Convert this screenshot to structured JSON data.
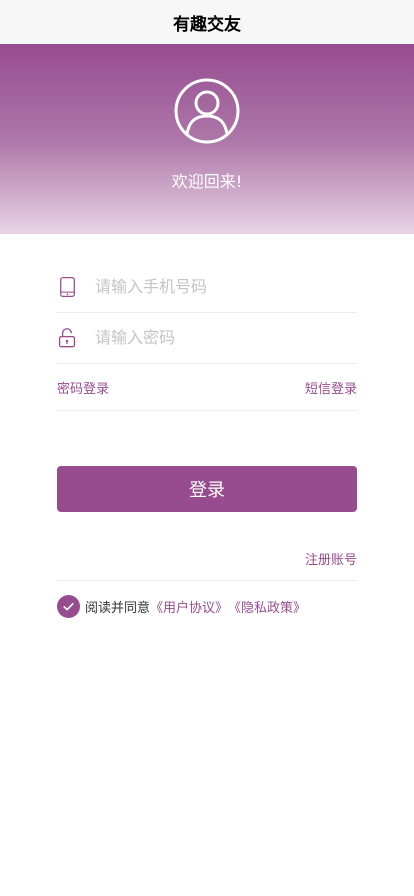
{
  "nav": {
    "title": "有趣交友"
  },
  "header": {
    "welcome_text": "欢迎回来!",
    "avatar_icon": "user-avatar-icon",
    "gradient_top": "#974c90",
    "gradient_bottom": "#e8d3e5"
  },
  "form": {
    "phone": {
      "icon": "phone-icon",
      "placeholder": "请输入手机号码",
      "value": ""
    },
    "password": {
      "icon": "lock-icon",
      "placeholder": "请输入密码",
      "value": ""
    },
    "password_login_label": "密码登录",
    "sms_login_label": "短信登录",
    "login_button_label": "登录",
    "register_label": "注册账号"
  },
  "agreement": {
    "checked": true,
    "prefix": "阅读并同意",
    "user_agreement": "《用户协议》",
    "privacy_policy": "《隐私政策》"
  },
  "colors": {
    "accent": "#974c8f",
    "placeholder": "#c4c4c4",
    "divider": "#ececec"
  }
}
